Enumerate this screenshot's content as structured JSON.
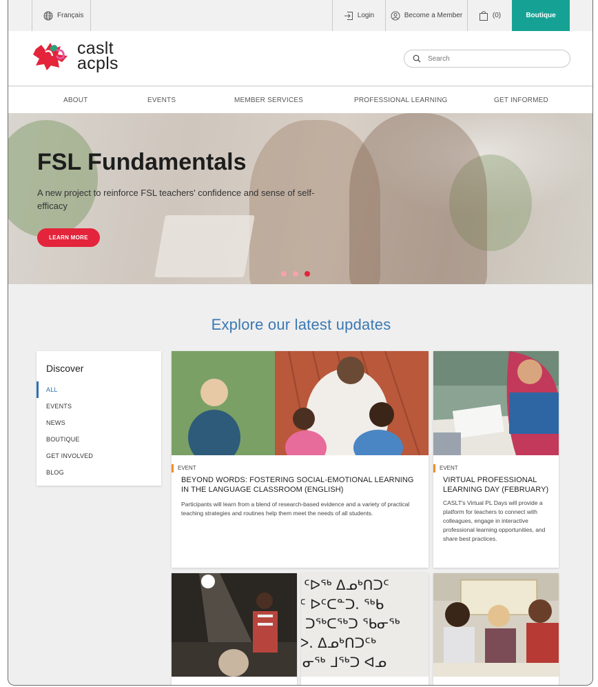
{
  "utility": {
    "language": "Français",
    "login": "Login",
    "member": "Become a Member",
    "cart": "(0)",
    "boutique": "Boutique"
  },
  "brand": {
    "line1": "caslt",
    "line2": "acpls",
    "colors": {
      "red": "#e3243b",
      "green": "#2ea07a",
      "pink": "#e25ba0"
    }
  },
  "search": {
    "placeholder": "Search"
  },
  "nav": [
    "ABOUT",
    "EVENTS",
    "MEMBER SERVICES",
    "PROFESSIONAL LEARNING",
    "GET INFORMED"
  ],
  "hero": {
    "title": "FSL Fundamentals",
    "subtitle": "A new project to reinforce FSL teachers' confidence and sense of self-efficacy",
    "button": "LEARN MORE",
    "slides": 3,
    "active_slide": 3
  },
  "section": {
    "title": "Explore our latest updates"
  },
  "discover": {
    "heading": "Discover",
    "items": [
      "ALL",
      "EVENTS",
      "NEWS",
      "BOUTIQUE",
      "GET INVOLVED",
      "BLOG"
    ],
    "active": "ALL"
  },
  "cards": [
    {
      "type": "EVENT",
      "title": "BEYOND WORDS: FOSTERING SOCIAL-EMOTIONAL LEARNING IN THE LANGUAGE CLASSROOM (ENGLISH)",
      "description": "Participants will learn from a blend of research-based evidence and a variety of practical teaching strategies and routines help them meet the needs of all students."
    },
    {
      "type": "EVENT",
      "title": "VIRTUAL PROFESSIONAL LEARNING DAY (FEBRUARY)",
      "description": "CASLT's Virtual PL Days will provide a platform for teachers to connect with colleagues, engage in interactive professional learning opportunities, and share best practices."
    }
  ],
  "syllabics_text": [
    "ᑦᐅᖅ ᐃᓄᒃᑎᑐᑦ",
    "ᑦ ᐅᑦᑕᓐᑐ. ᖅᑲ",
    "ᑐᖅᑕᖅᑐ ᖃᓂᖅ",
    "ᐅ. ᐃᓄᒃᑎᑐᑦᒃ",
    "ᓂᖅ ᒧᖅᑐ ᐊᓄ"
  ],
  "colors": {
    "accent_blue": "#3a78b3",
    "teal": "#15a294",
    "event_orange": "#ef8c2a"
  }
}
